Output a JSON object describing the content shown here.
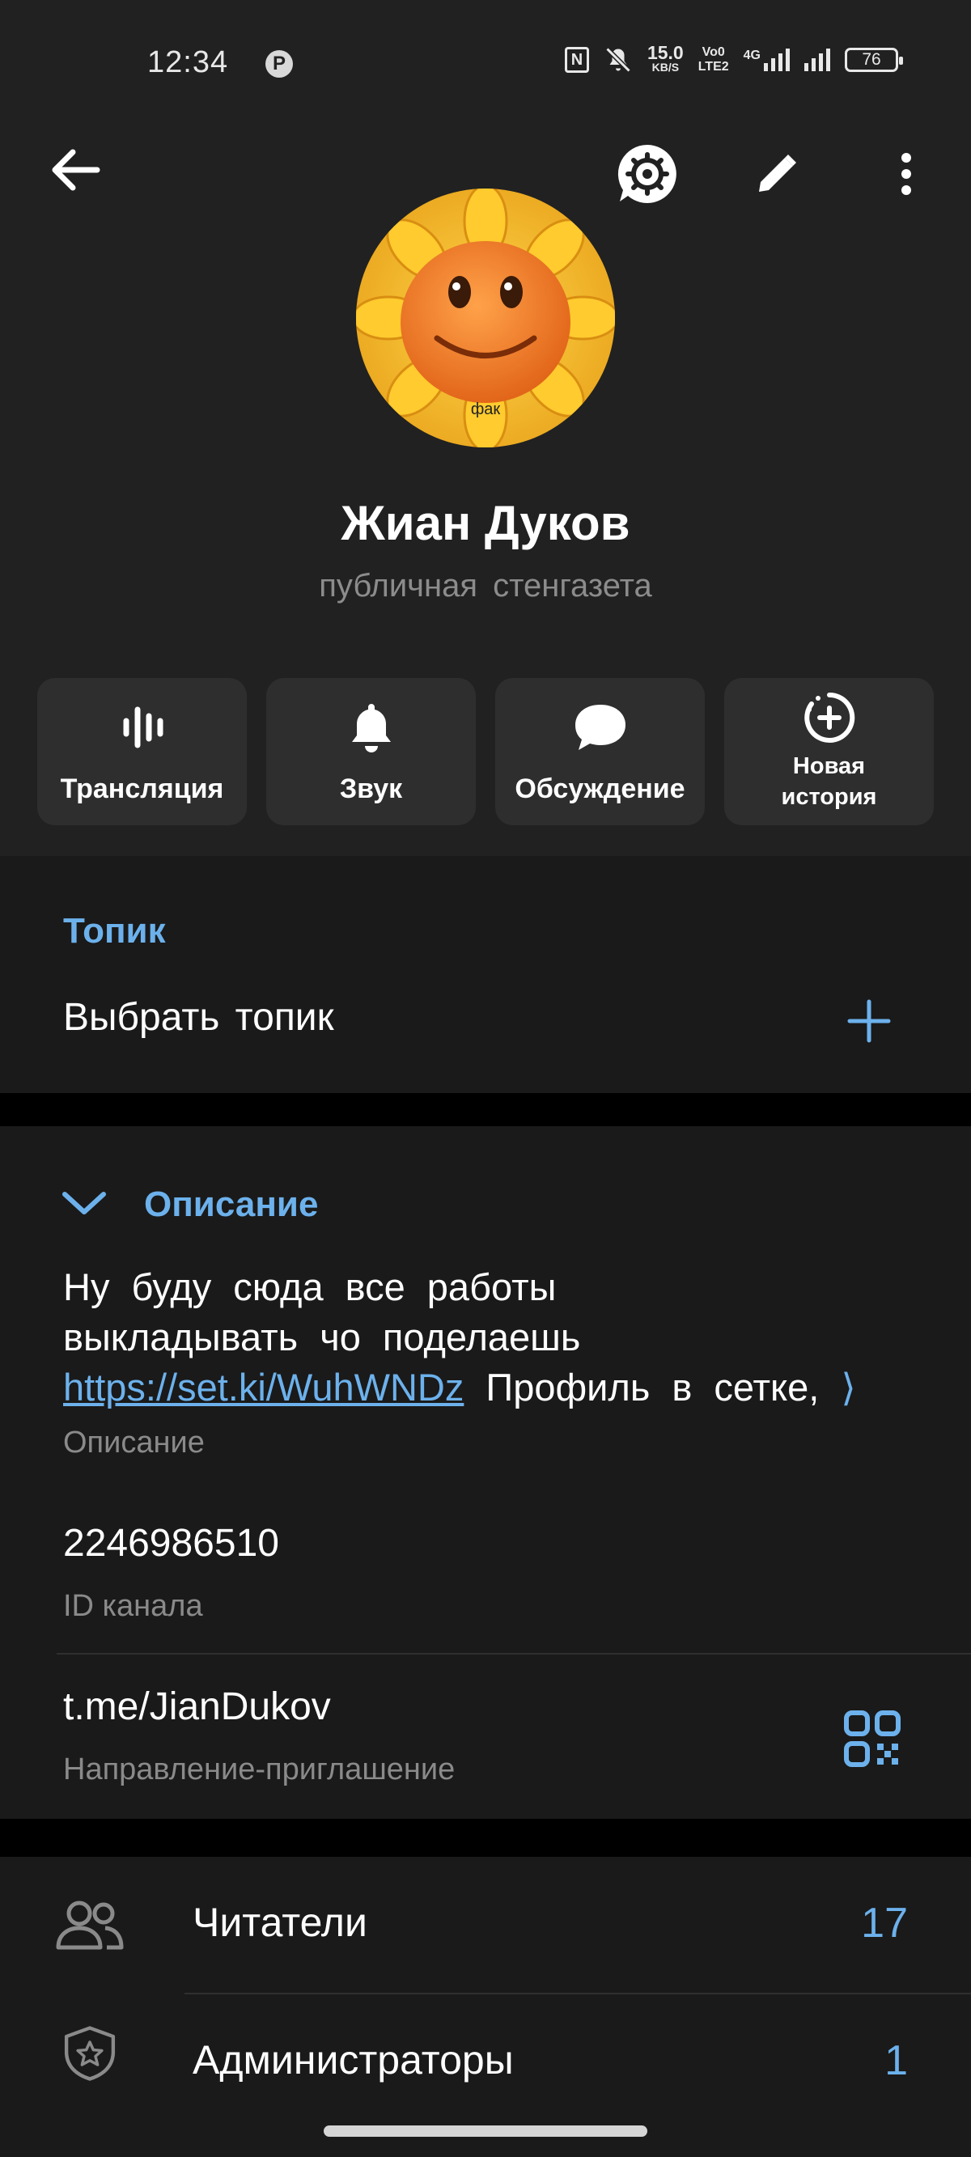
{
  "status_bar": {
    "time": "12:34",
    "pinterest_glyph": "P",
    "nfc_glyph": "N",
    "speed_value": "15.0",
    "speed_unit": "KB/S",
    "volte_top": "Vo0",
    "volte_bottom": "LTE2",
    "network": "4G",
    "battery": "76"
  },
  "toolbar": {
    "back_icon": "arrow-left-icon",
    "actions": [
      "chat-settings-icon",
      "pencil-icon",
      "more-vertical-icon"
    ]
  },
  "profile": {
    "avatar_label": "фак",
    "name": "Жиан Дуков",
    "subtitle": "публичная стенгазета"
  },
  "actions": [
    {
      "label": "Трансляция",
      "icon": "live-stream-icon"
    },
    {
      "label": "Звук",
      "icon": "bell-icon"
    },
    {
      "label": "Обсуждение",
      "icon": "chat-bubble-icon"
    },
    {
      "label": "Новая\nистория",
      "icon": "add-story-icon"
    }
  ],
  "topic": {
    "section_title": "Топик",
    "choose_label": "Выбрать топик"
  },
  "description": {
    "section_title": "Описание",
    "line1": "Ну буду сюда все работы",
    "line2": "выкладывать чо поделаешь",
    "link": "https://set.ki/WuhWNDz",
    "line3_rest": "Профиль в сетке,",
    "more": "⟩",
    "caption": "Описание"
  },
  "channel_id": {
    "value": "2246986510",
    "caption": "ID канала"
  },
  "invite": {
    "value": "t.me/JianDukov",
    "caption": "Направление-приглашение"
  },
  "list": [
    {
      "label": "Читатели",
      "value": "17",
      "icon": "users-icon"
    },
    {
      "label": "Администраторы",
      "value": "1",
      "icon": "shield-star-icon"
    }
  ],
  "colors": {
    "accent": "#6cb1ec",
    "header_bg": "#212121",
    "card_bg": "#1a1a1a",
    "button_bg": "#2e2e2e"
  }
}
